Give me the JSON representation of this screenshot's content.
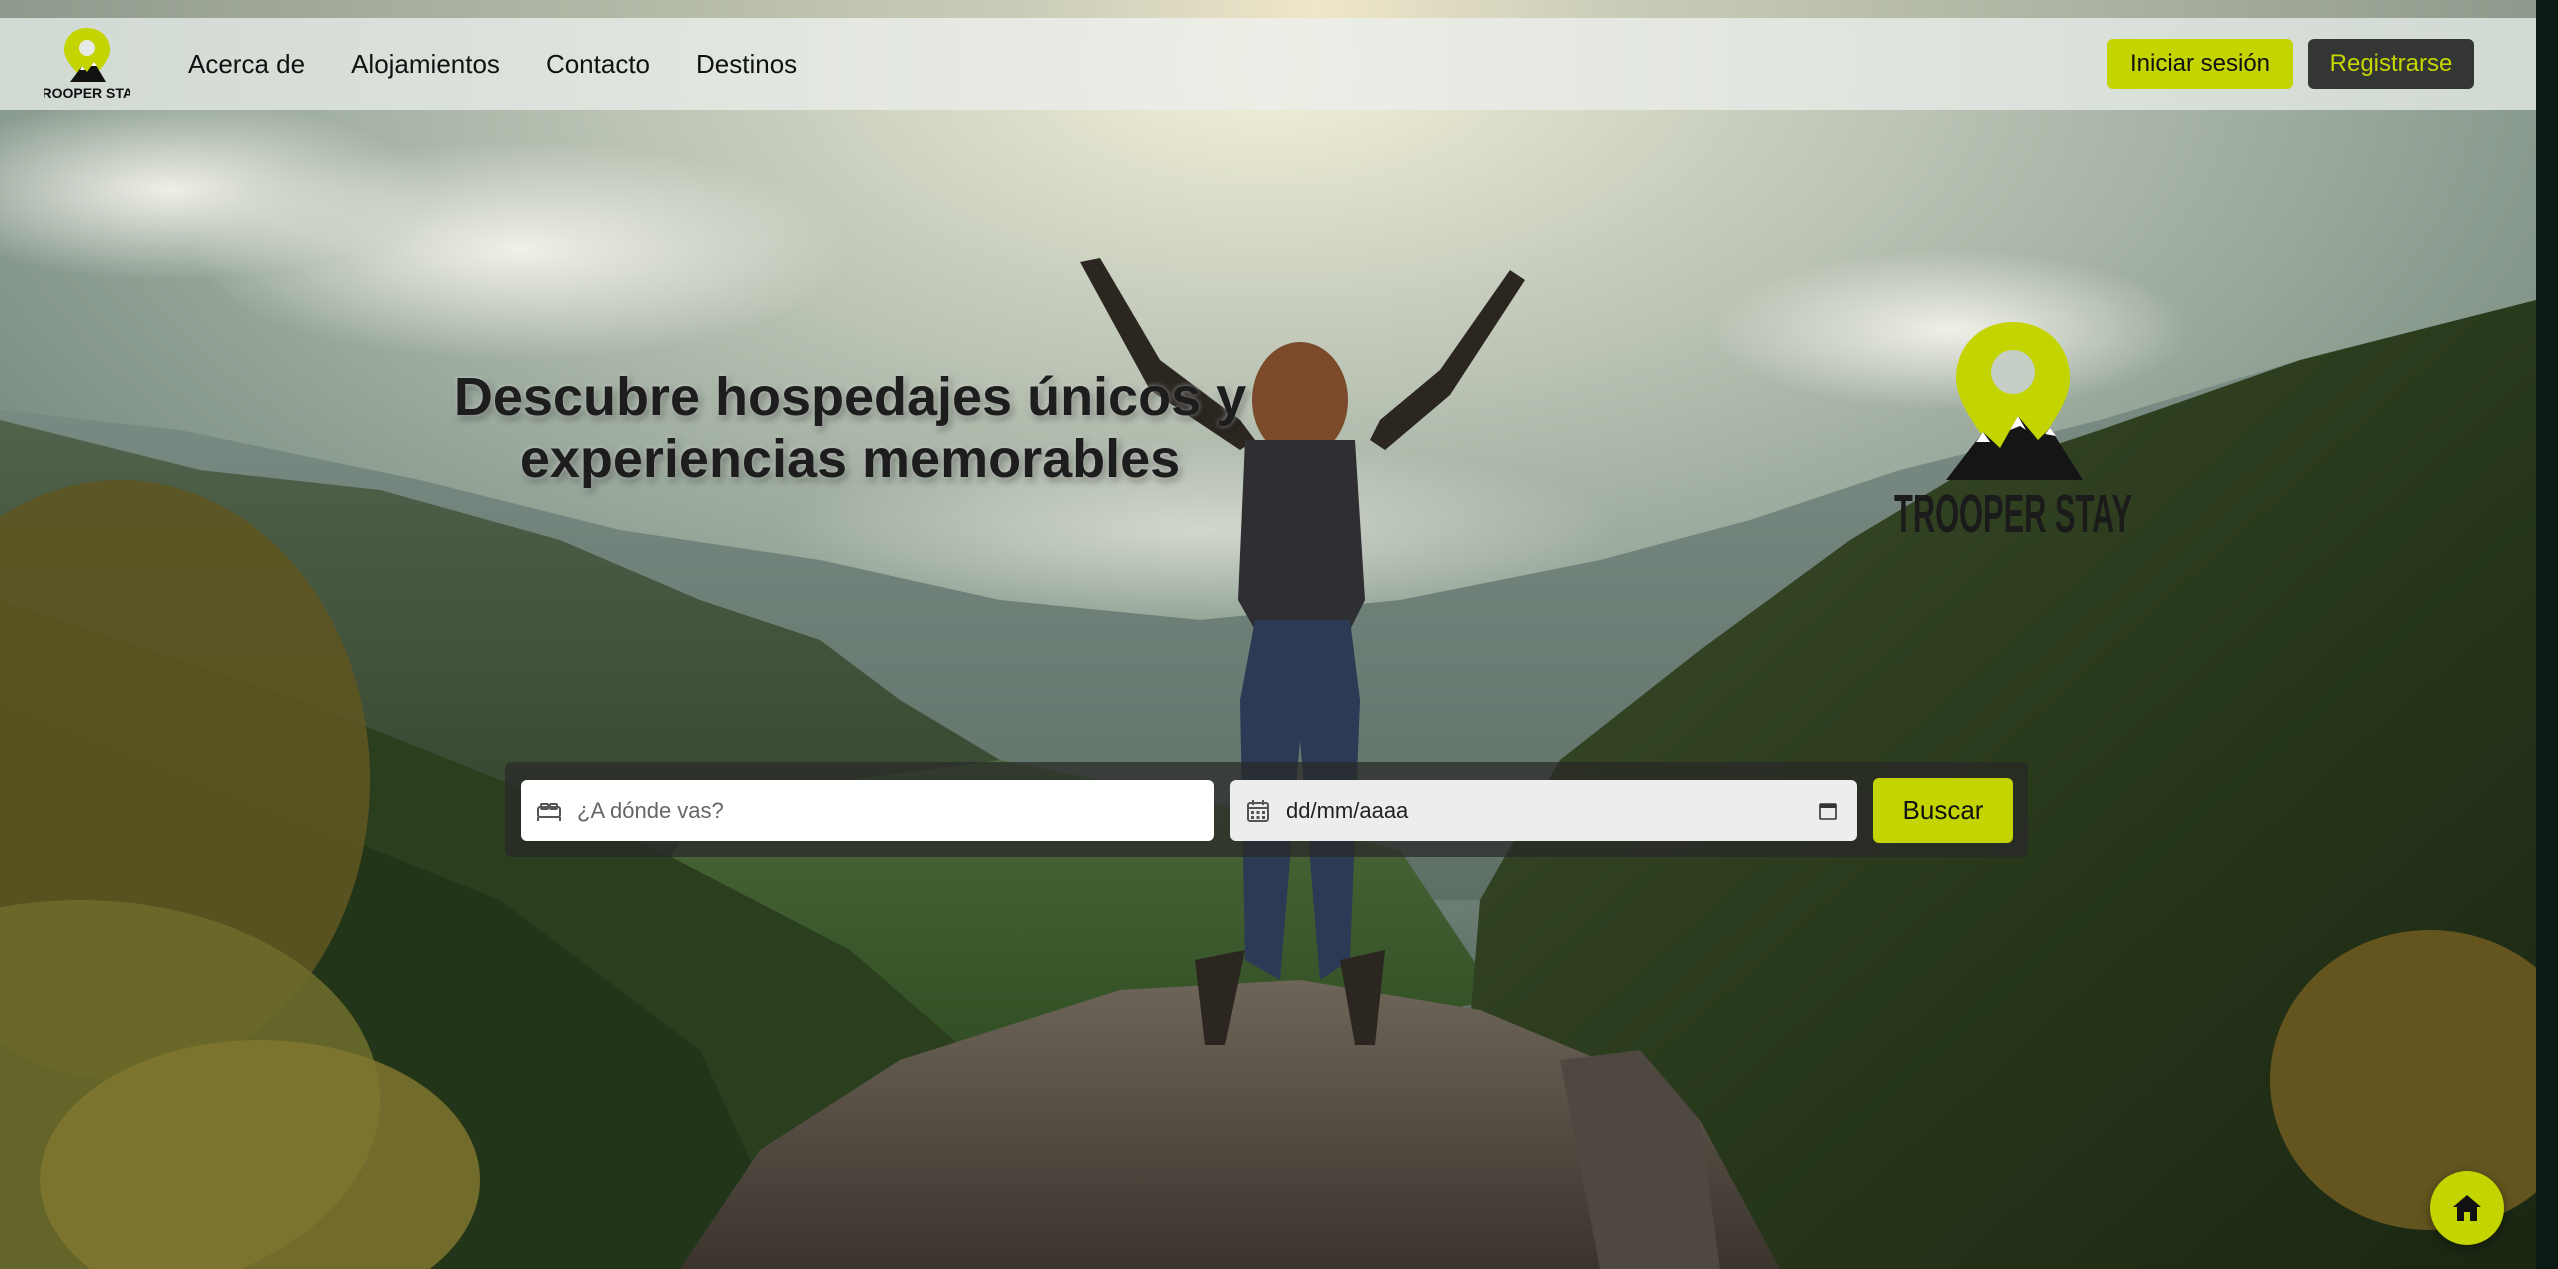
{
  "brand": {
    "name": "TROOPER STAY",
    "accent_color": "#c3d400",
    "dark_color": "#333633",
    "logo_icon": "map-pin-mountain-icon"
  },
  "nav": {
    "links": [
      "Acerca de",
      "Alojamientos",
      "Contacto",
      "Destinos"
    ],
    "login_label": "Iniciar sesión",
    "register_label": "Registrarse"
  },
  "hero": {
    "headline_line1": "Descubre hospedajes únicos y",
    "headline_line2": "experiencias memorables",
    "background": "person jumping on mountain summit with forested valley"
  },
  "search": {
    "destination_placeholder": "¿A dónde vas?",
    "destination_icon": "bed-icon",
    "date_value": "dd/mm/aaaa",
    "date_icon": "calendar-icon",
    "button_label": "Buscar"
  },
  "fab": {
    "icon": "home-icon"
  }
}
